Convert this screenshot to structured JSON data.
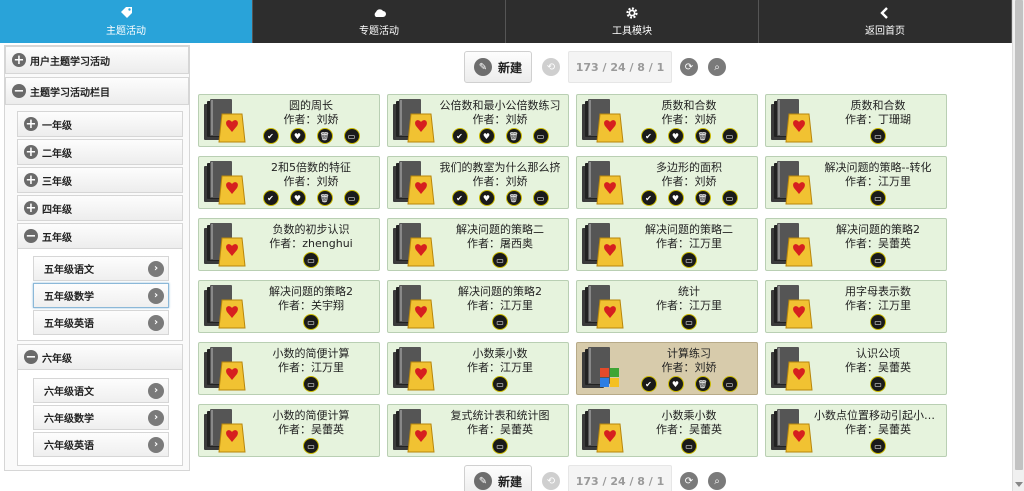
{
  "nav": [
    {
      "label": "主题活动",
      "icon": "tag-icon",
      "active": true
    },
    {
      "label": "专题活动",
      "icon": "cloud-icon",
      "active": false
    },
    {
      "label": "工具模块",
      "icon": "gear-icon",
      "active": false
    },
    {
      "label": "返回首页",
      "icon": "chevron-left-icon",
      "active": false
    }
  ],
  "sidebar": {
    "user_topics": "用户主题学习活动",
    "topic_column": "主题学习活动栏目",
    "grades": {
      "g1": "一年级",
      "g2": "二年级",
      "g3": "三年级",
      "g4": "四年级",
      "g5": "五年级",
      "g6": "六年级"
    },
    "g5_subjects": [
      "五年级语文",
      "五年级数学",
      "五年级英语"
    ],
    "g6_subjects": [
      "六年级语文",
      "六年级数学",
      "六年级英语"
    ],
    "selected": "五年级数学"
  },
  "pager": {
    "new_label": "新建",
    "info": "173 / 24 / 8 / 1"
  },
  "author_prefix": "作者：",
  "cards": [
    {
      "title": "圆的周长",
      "author": "刘娇",
      "full": true
    },
    {
      "title": "公倍数和最小公倍数练习",
      "author": "刘娇",
      "full": true
    },
    {
      "title": "质数和合数",
      "author": "刘娇",
      "full": true
    },
    {
      "title": "质数和合数",
      "author": "丁珊瑚",
      "full": false
    },
    {
      "title": "2和5倍数的特征",
      "author": "刘娇",
      "full": true
    },
    {
      "title": "我们的教室为什么那么挤",
      "author": "刘娇",
      "full": true
    },
    {
      "title": "多边形的面积",
      "author": "刘娇",
      "full": true
    },
    {
      "title": "解决问题的策略--转化",
      "author": "江万里",
      "full": false
    },
    {
      "title": "负数的初步认识",
      "author": "zhenghui",
      "full": false
    },
    {
      "title": "解决问题的策略二",
      "author": "屠西奥",
      "full": false
    },
    {
      "title": "解决问题的策略二",
      "author": "江万里",
      "full": false
    },
    {
      "title": "解决问题的策略2",
      "author": "吴蕾英",
      "full": false
    },
    {
      "title": "解决问题的策略2",
      "author": "关宇翔",
      "full": false
    },
    {
      "title": "解决问题的策略2",
      "author": "江万里",
      "full": false
    },
    {
      "title": "统计",
      "author": "江万里",
      "full": false
    },
    {
      "title": "用字母表示数",
      "author": "江万里",
      "full": false
    },
    {
      "title": "小数的简便计算",
      "author": "江万里",
      "full": false
    },
    {
      "title": "小数乘小数",
      "author": "江万里",
      "full": false
    },
    {
      "title": "计算练习",
      "author": "刘娇",
      "full": true,
      "highlight": true
    },
    {
      "title": "认识公顷",
      "author": "吴蕾英",
      "full": false
    },
    {
      "title": "小数的简便计算",
      "author": "吴蕾英",
      "full": false
    },
    {
      "title": "复式统计表和统计图",
      "author": "吴蕾英",
      "full": false
    },
    {
      "title": "小数乘小数",
      "author": "吴蕾英",
      "full": false
    },
    {
      "title": "小数点位置移动引起小数大小的变化",
      "author": "吴蕾英",
      "full": false
    }
  ]
}
